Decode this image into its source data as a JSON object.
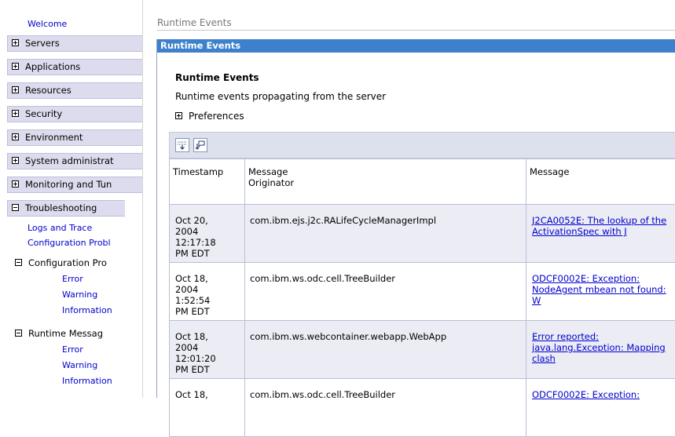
{
  "sidebar": {
    "welcome": "Welcome",
    "categories": [
      {
        "label": "Servers",
        "state": "collapsed"
      },
      {
        "label": "Applications",
        "state": "collapsed"
      },
      {
        "label": "Resources",
        "state": "collapsed"
      },
      {
        "label": "Security",
        "state": "collapsed"
      },
      {
        "label": "Environment",
        "state": "collapsed"
      },
      {
        "label": "System administrat",
        "state": "collapsed"
      },
      {
        "label": "Monitoring and Tun",
        "state": "collapsed"
      },
      {
        "label": "Troubleshooting",
        "state": "expanded"
      }
    ],
    "troubleshooting_links": [
      "Logs and Trace",
      "Configuration Probl"
    ],
    "config_problems": {
      "label": "Configuration Pro",
      "links": [
        "Error",
        "Warning",
        "Information"
      ]
    },
    "runtime_messages": {
      "label": "Runtime Messag",
      "links": [
        "Error",
        "Warning",
        "Information"
      ]
    }
  },
  "breadcrumb": "Runtime Events",
  "panel_title": "Runtime Events",
  "content": {
    "title": "Runtime Events",
    "description": "Runtime events propagating from the server",
    "preferences": "Preferences"
  },
  "toolbar": {
    "icons": [
      "expand-all-icon",
      "collapse-all-icon"
    ]
  },
  "table": {
    "headers": {
      "timestamp": "Timestamp",
      "originator_1": "Message",
      "originator_2": "Originator",
      "message": "Message"
    },
    "rows": [
      {
        "ts": [
          "Oct 20,",
          "2004",
          "12:17:18",
          "PM EDT"
        ],
        "originator": "com.ibm.ejs.j2c.RALifeCycleManagerImpl",
        "message": "J2CA0052E: The lookup of the ActivationSpec with J"
      },
      {
        "ts": [
          "Oct 18,",
          "2004",
          "1:52:54",
          "PM EDT"
        ],
        "originator": "com.ibm.ws.odc.cell.TreeBuilder",
        "message": "ODCF0002E: Exception: NodeAgent mbean not found: W"
      },
      {
        "ts": [
          "Oct 18,",
          "2004",
          "12:01:20",
          "PM EDT"
        ],
        "originator": "com.ibm.ws.webcontainer.webapp.WebApp",
        "message": "Error reported: java.lang.Exception: Mapping clash"
      },
      {
        "ts": [
          "Oct 18,",
          "",
          "",
          ""
        ],
        "originator": "com.ibm.ws.odc.cell.TreeBuilder",
        "message": "ODCF0002E: Exception:"
      }
    ]
  },
  "colors": {
    "panel_header": "#3d80cc",
    "nav_bg": "#dcdcee",
    "link": "#0000cc",
    "row_shade": "#ececf5"
  }
}
